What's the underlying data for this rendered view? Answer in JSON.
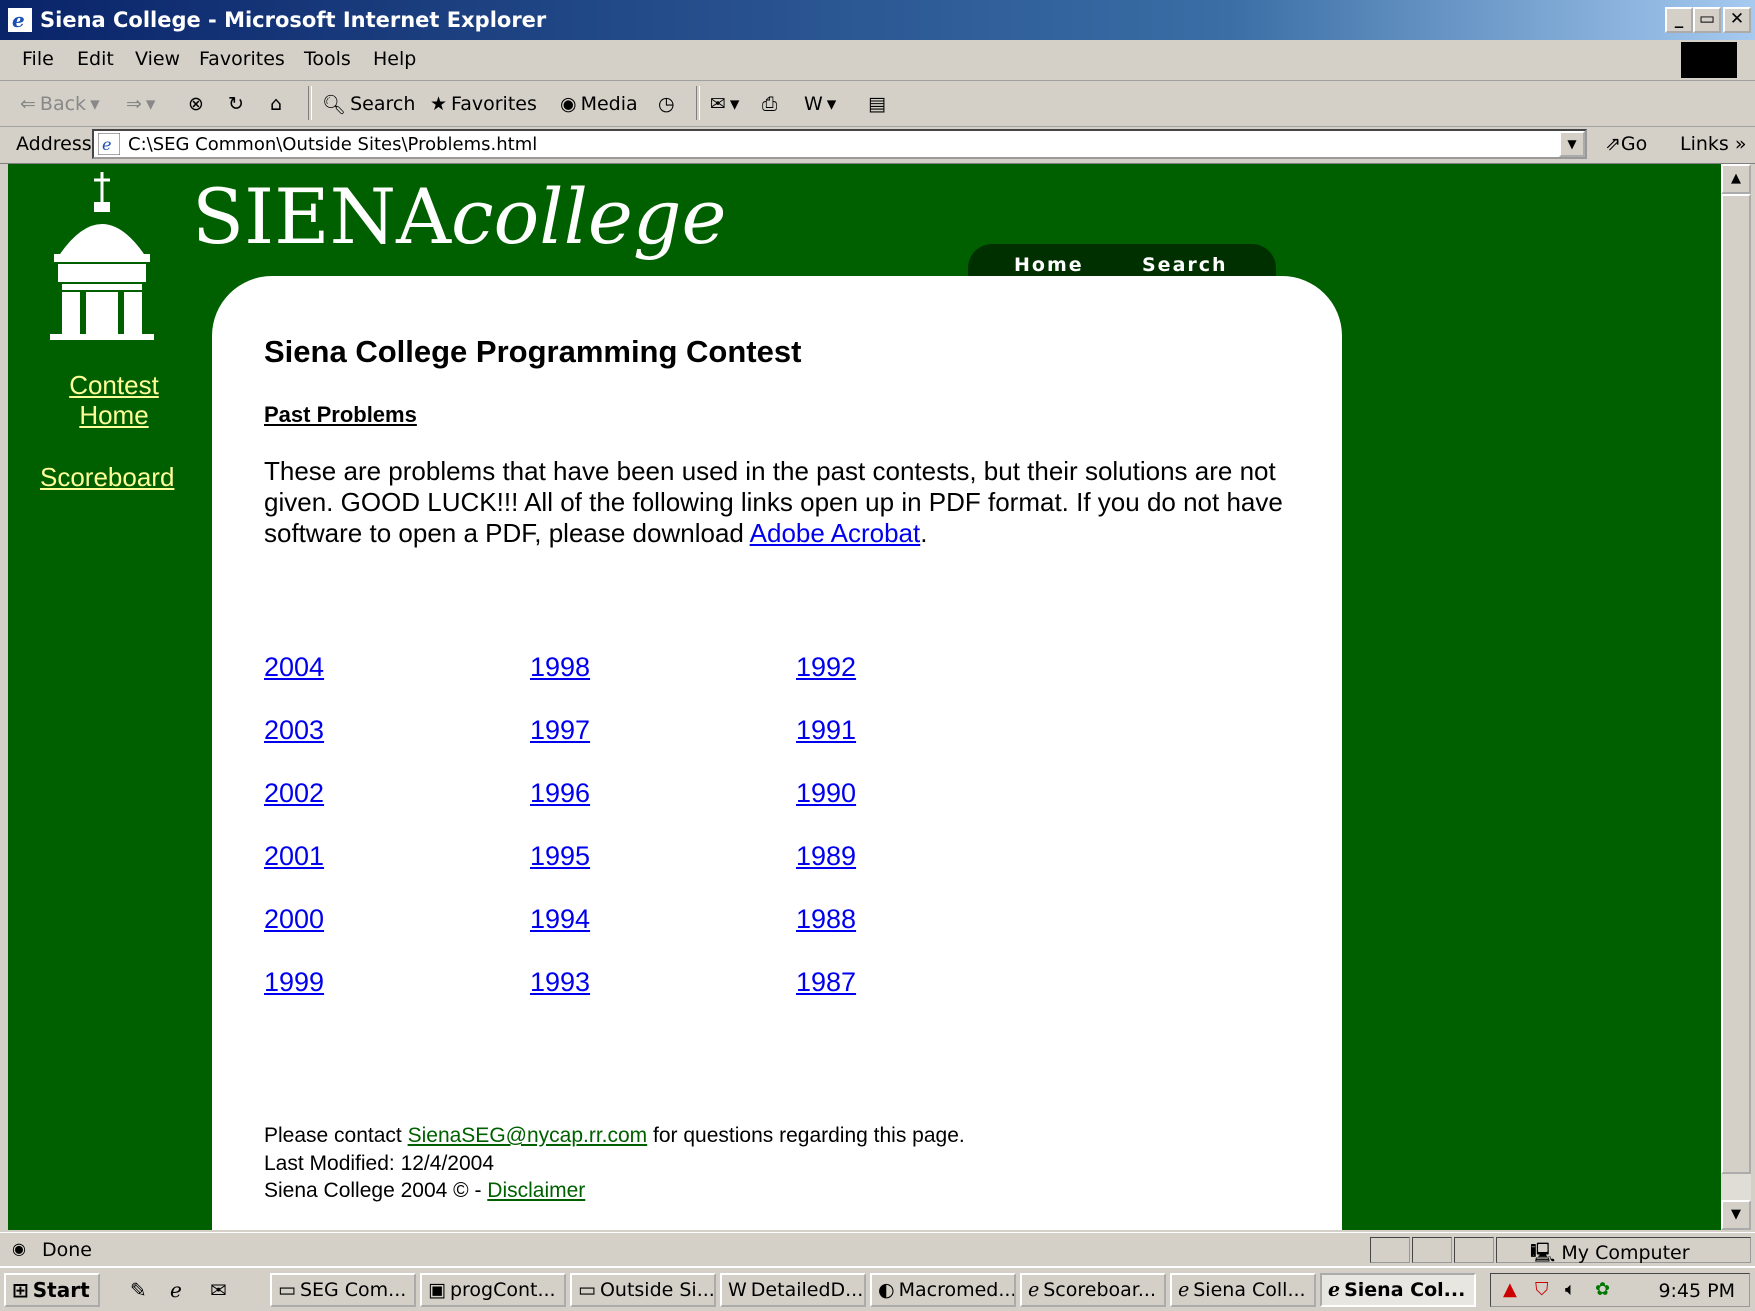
{
  "window": {
    "title": "Siena College - Microsoft Internet Explorer",
    "controls": [
      "_",
      "▭",
      "✕"
    ]
  },
  "menu": [
    "File",
    "Edit",
    "View",
    "Favorites",
    "Tools",
    "Help"
  ],
  "toolbar": {
    "back": "Back",
    "search": "Search",
    "favorites": "Favorites",
    "media": "Media"
  },
  "address": {
    "label": "Address",
    "url": "C:\\SEG Common\\Outside Sites\\Problems.html",
    "go": "Go",
    "links": "Links"
  },
  "page": {
    "logo_main": "SIENA",
    "logo_italic": "college",
    "tabs": [
      "Home",
      "Search"
    ],
    "sidebar": {
      "contest_home_1": "Contest",
      "contest_home_2": "Home",
      "scoreboard": "Scoreboard"
    },
    "heading": "Siena College Programming Contest",
    "subheading": "Past Problems",
    "intro_before_link": "These are problems that have been used in the past contests, but their solutions are not given. GOOD LUCK!!! All of the following links open up in PDF format. If you do not have software to open a PDF, please download ",
    "intro_link": "Adobe Acrobat",
    "intro_after_link": ".",
    "years": [
      [
        "2004",
        "2003",
        "2002",
        "2001",
        "2000",
        "1999"
      ],
      [
        "1998",
        "1997",
        "1996",
        "1995",
        "1994",
        "1993"
      ],
      [
        "1992",
        "1991",
        "1990",
        "1989",
        "1988",
        "1987"
      ]
    ],
    "footer": {
      "contact_before": "Please contact ",
      "contact_email": "SienaSEG@nycap.rr.com",
      "contact_after": " for questions regarding this page.",
      "last_modified": "Last Modified: 12/4/2004",
      "copyright": "Siena College 2004 © - ",
      "disclaimer": "Disclaimer"
    }
  },
  "status": {
    "text": "Done",
    "zone": "My Computer"
  },
  "taskbar": {
    "start": "Start",
    "tasks": [
      "SEG Com...",
      "progCont...",
      "Outside Si...",
      "DetailedD...",
      "Macromed...",
      "Scoreboar...",
      "Siena Coll...",
      "Siena Col..."
    ],
    "clock": "9:45 PM"
  },
  "colors": {
    "page_bg": "#006000",
    "tab_bg": "#003000",
    "link": "#0000ee",
    "sidebar_link": "#ffff99"
  }
}
